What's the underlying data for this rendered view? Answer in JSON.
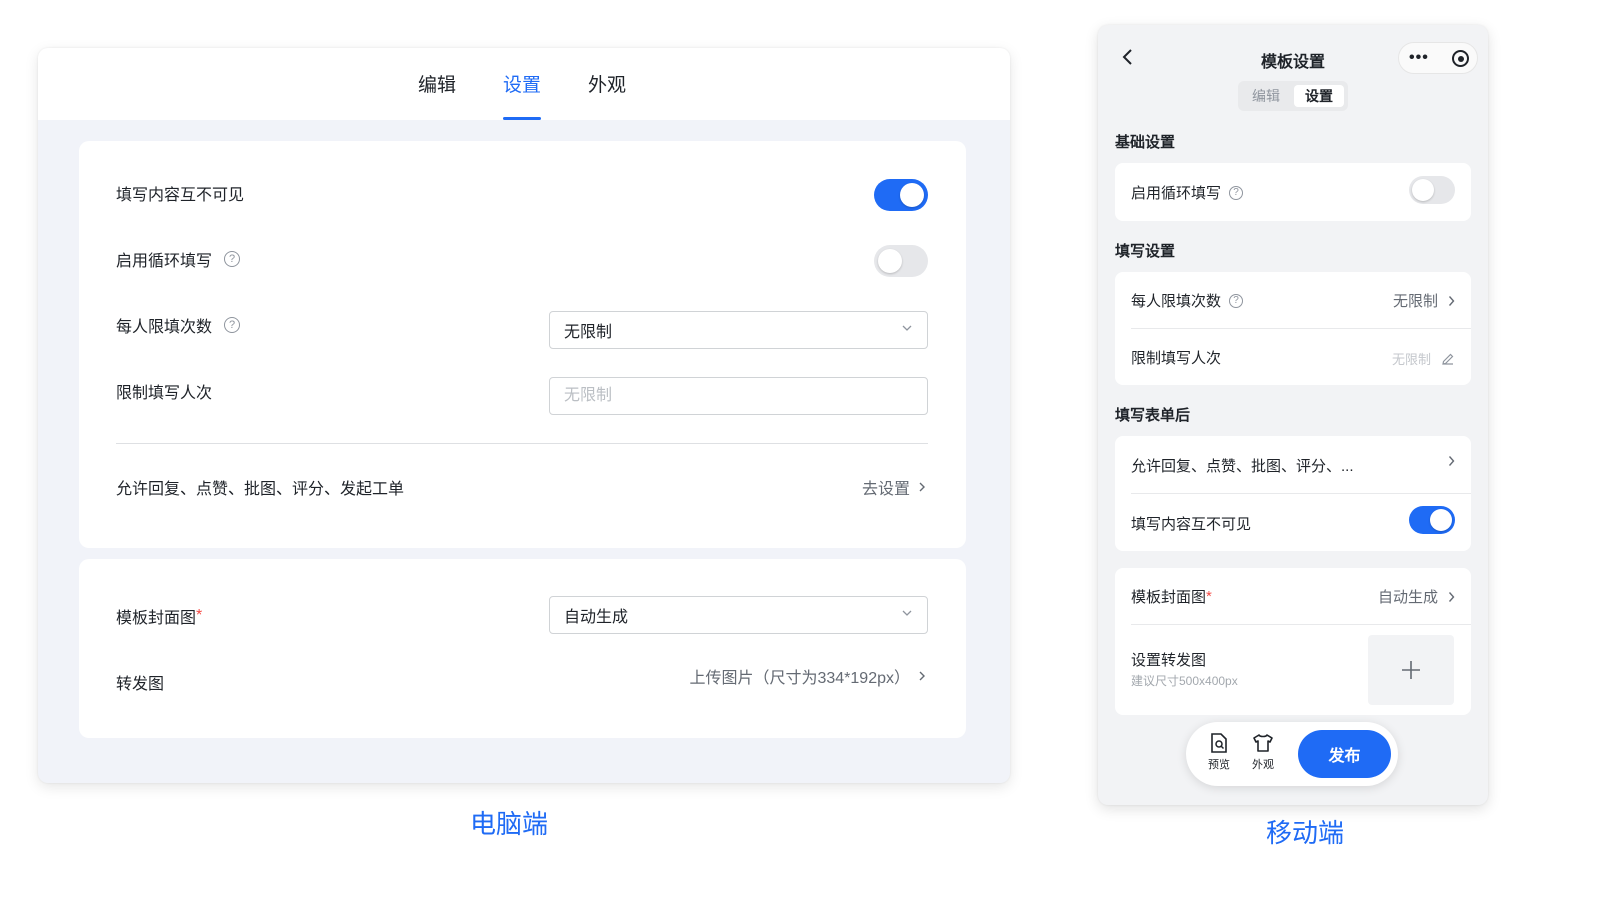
{
  "desktop": {
    "tabs": [
      {
        "label": "编辑",
        "active": false
      },
      {
        "label": "设置",
        "active": true
      },
      {
        "label": "外观",
        "active": false
      }
    ],
    "settings": {
      "hide_content_label": "填写内容互不可见",
      "hide_content_on": true,
      "loop_fill_label": "启用循环填写",
      "loop_fill_on": false,
      "per_person_label": "每人限填次数",
      "per_person_value": "无限制",
      "limit_total_label": "限制填写人次",
      "limit_total_placeholder": "无限制",
      "interactions_label": "允许回复、点赞、批图、评分、发起工单",
      "interactions_link": "去设置"
    },
    "cover": {
      "cover_label": "模板封面图",
      "cover_value": "自动生成",
      "share_label": "转发图",
      "share_value": "上传图片（尺寸为334*192px）"
    },
    "caption": "电脑端"
  },
  "mobile": {
    "title": "模板设置",
    "more_label": "•••",
    "tabs": [
      {
        "label": "编辑",
        "active": false
      },
      {
        "label": "设置",
        "active": true
      }
    ],
    "basic": {
      "section_title": "基础设置",
      "loop_fill_label": "启用循环填写",
      "loop_fill_on": false
    },
    "fill": {
      "section_title": "填写设置",
      "per_person_label": "每人限填次数",
      "per_person_value": "无限制",
      "limit_total_label": "限制填写人次",
      "limit_total_placeholder": "无限制"
    },
    "after": {
      "section_title": "填写表单后",
      "interactions_label": "允许回复、点赞、批图、评分、...",
      "hide_content_label": "填写内容互不可见",
      "hide_content_on": true
    },
    "cover": {
      "cover_label": "模板封面图",
      "cover_value": "自动生成",
      "share_label": "设置转发图",
      "share_hint": "建议尺寸500x400px"
    },
    "bottom_bar": {
      "preview_label": "预览",
      "appearance_label": "外观",
      "publish_label": "发布"
    },
    "caption": "移动端"
  },
  "colors": {
    "accent": "#1f6bf5",
    "required": "#f54a45",
    "page_bg": "#f1f3f9"
  },
  "icons": [
    "chevron-down-icon",
    "chevron-right-icon",
    "help-icon",
    "back-icon",
    "more-icon",
    "target-icon",
    "edit-icon",
    "plus-icon",
    "preview-icon",
    "shirt-icon"
  ]
}
